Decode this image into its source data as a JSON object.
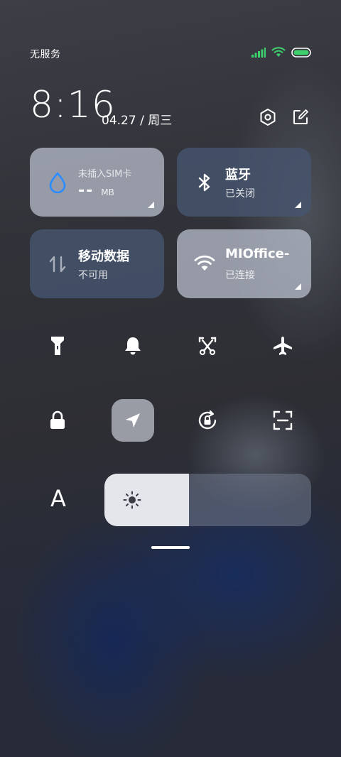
{
  "status": {
    "carrier": "无服务",
    "icons": [
      "signal-icon",
      "wifi-icon",
      "battery-icon"
    ],
    "signal_color": "#3ecf6e",
    "wifi_color": "#3ecf6e",
    "battery_color": "#3ecf6e"
  },
  "header": {
    "time": "8:16",
    "date": "04.27 / 周三",
    "settings_icon": "settings-icon",
    "edit_icon": "edit-icon"
  },
  "tiles": {
    "data_usage": {
      "label": "未插入SIM卡",
      "value": "--",
      "unit": "MB",
      "icon": "drop-icon",
      "icon_color": "#2a8cff"
    },
    "bluetooth": {
      "title": "蓝牙",
      "status": "已关闭",
      "icon": "bluetooth-icon"
    },
    "mobile_data": {
      "title": "移动数据",
      "status": "不可用",
      "icon": "mobile-data-icon"
    },
    "wifi": {
      "title": "MIOffice-",
      "status": "已连接",
      "icon": "wifi-icon"
    }
  },
  "toggles": {
    "row1": [
      "flashlight-icon",
      "bell-icon",
      "screenshot-icon",
      "airplane-icon"
    ],
    "row2": [
      "lock-icon",
      "location-icon",
      "rotation-lock-icon",
      "scan-icon"
    ],
    "active": [
      "location-icon"
    ]
  },
  "brightness": {
    "font_label": "A",
    "level": 0.41,
    "icon": "sun-icon"
  }
}
